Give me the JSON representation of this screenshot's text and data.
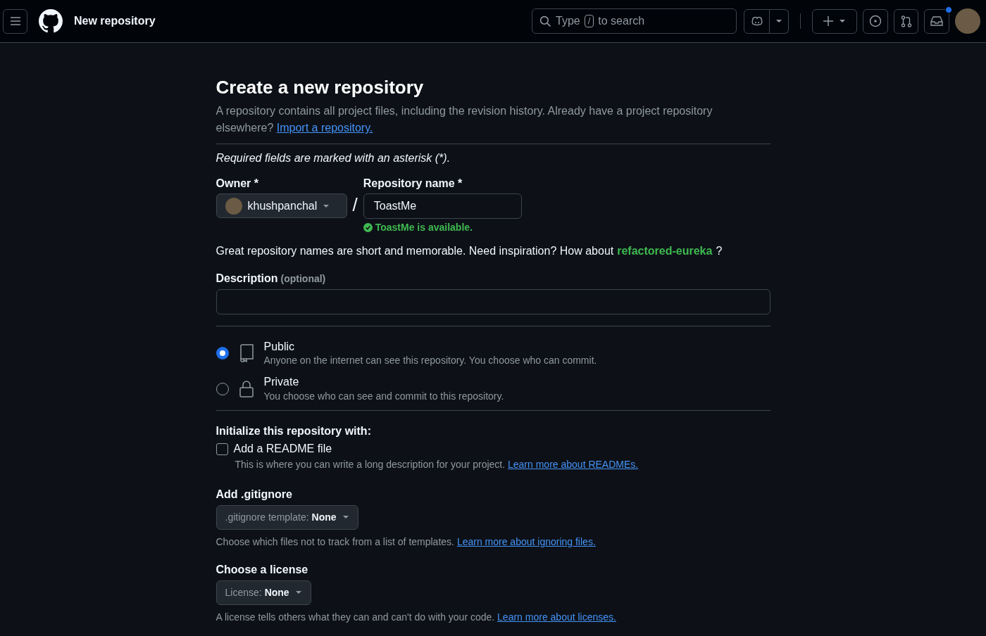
{
  "header": {
    "title": "New repository",
    "search": {
      "prefix": "Type",
      "key": "/",
      "suffix": "to search"
    },
    "inbox_unread": true
  },
  "heading": "Create a new repository",
  "intro": {
    "text": "A repository contains all project files, including the revision history. Already have a project repository elsewhere?",
    "link": "Import a repository."
  },
  "required_note": "Required fields are marked with an asterisk (*).",
  "owner": {
    "label": "Owner *",
    "value": "khushpanchal"
  },
  "separator": "/",
  "repo_name": {
    "label": "Repository name *",
    "value": "ToastMe",
    "status": "ToastMe is available."
  },
  "suggestion": {
    "text": "Great repository names are short and memorable. Need inspiration? How about",
    "name": "refactored-eureka",
    "end": "?"
  },
  "description": {
    "label": "Description",
    "hint": "(optional)"
  },
  "visibility": [
    {
      "kind": "book",
      "title": "Public",
      "text": "Anyone on the internet can see this repository. You choose who can commit.",
      "selected": true
    },
    {
      "kind": "lock",
      "title": "Private",
      "text": "You choose who can see and commit to this repository.",
      "selected": false
    }
  ],
  "init": {
    "heading": "Initialize this repository with:",
    "readme": {
      "label": "Add a README file",
      "checked": false,
      "help": "This is where you can write a long description for your project.",
      "link": "Learn more about READMEs."
    }
  },
  "selects": [
    {
      "heading": "Add .gitignore",
      "prefix": ".gitignore template:",
      "value": "None",
      "help": "Choose which files not to track from a list of templates.",
      "link": "Learn more about ignoring files."
    },
    {
      "heading": "Choose a license",
      "prefix": "License:",
      "value": "None",
      "help": "A license tells others what they can and can't do with your code.",
      "link": "Learn more about licenses."
    }
  ]
}
